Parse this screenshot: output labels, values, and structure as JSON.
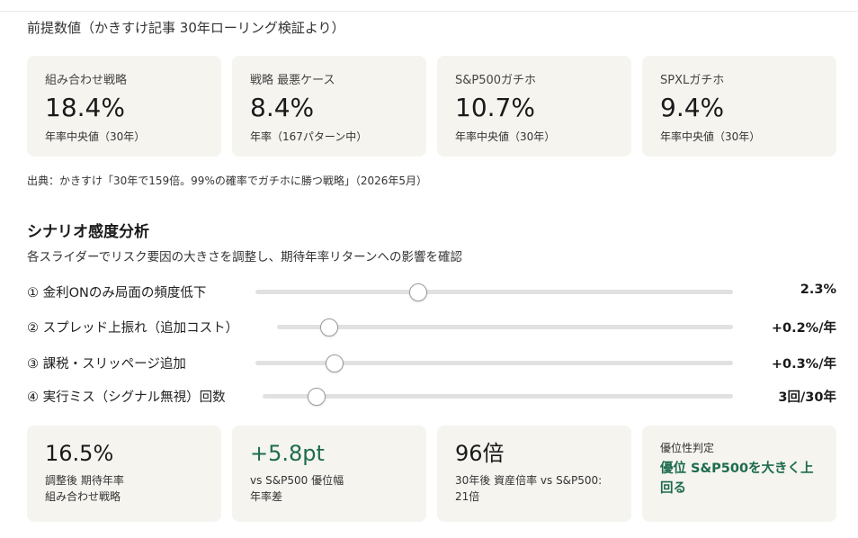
{
  "premise": {
    "title": "前提数値（かきすけ記事 30年ローリング検証より）",
    "cards": [
      {
        "label": "組み合わせ戦略",
        "value": "18.4%",
        "note": "年率中央値（30年）"
      },
      {
        "label": "戦略 最悪ケース",
        "value": "8.4%",
        "note": "年率（167パターン中）"
      },
      {
        "label": "S&P500ガチホ",
        "value": "10.7%",
        "note": "年率中央値（30年）"
      },
      {
        "label": "SPXLガチホ",
        "value": "9.4%",
        "note": "年率中央値（30年）"
      }
    ],
    "source": "出典：かきすけ「30年で159倍。99%の確率でガチホに勝つ戦略」（2026年5月）"
  },
  "scenario": {
    "title": "シナリオ感度分析",
    "description": "各スライダーでリスク要因の大きさを調整し、期待年率リターンへの影響を確認",
    "sliders": [
      {
        "label": "① 金利ONのみ局面の頻度低下",
        "value_text": "2.3%",
        "position": 0.34
      },
      {
        "label": "② スプレッド上振れ（追加コスト）",
        "value_text": "+0.2%/年",
        "position": 0.115
      },
      {
        "label": "③ 課税・スリッページ追加",
        "value_text": "+0.3%/年",
        "position": 0.165
      },
      {
        "label": "④ 実行ミス（シグナル無視）回数",
        "value_text": "3回/30年",
        "position": 0.115
      }
    ]
  },
  "results": {
    "expected": {
      "value": "16.5%",
      "line1": "調整後 期待年率",
      "line2": "組み合わせ戦略"
    },
    "advantage": {
      "value": "+5.8pt",
      "line1": "vs S&P500 優位幅",
      "line2": "年率差"
    },
    "multiple": {
      "value": "96倍",
      "line1": "30年後 資産倍率 vs S&P500: 21倍"
    },
    "verdict": {
      "label": "優位性判定",
      "text": "優位 S&P500を大きく上回る"
    }
  },
  "colors": {
    "card_bg": "#f5f4ef",
    "accent_green": "#1e6b4f",
    "track": "#e1e1e1"
  }
}
